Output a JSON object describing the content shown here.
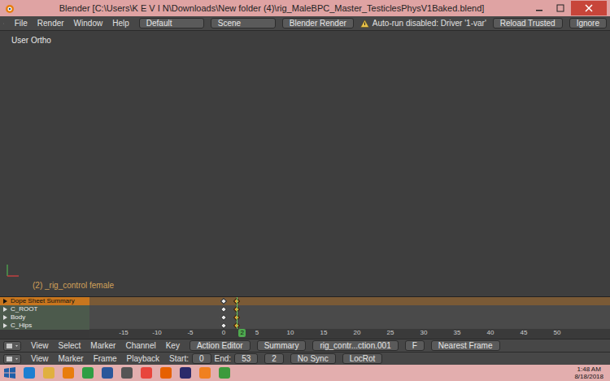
{
  "window": {
    "title": "Blender [C:\\Users\\K E V I N\\Downloads\\New folder (4)\\rig_MaleBPC_Master_TesticlesPhysV1Baked.blend]"
  },
  "info_header": {
    "menus": [
      "File",
      "Render",
      "Window",
      "Help"
    ],
    "layout": "Default",
    "scene": "Scene",
    "engine": "Blender Render",
    "warning": "Auto-run disabled: Driver '1-var'",
    "buttons": [
      "Reload Trusted",
      "Ignore"
    ]
  },
  "viewport": {
    "view_label": "User Ortho",
    "object_label": "(2) _rig_control female"
  },
  "dope_sheet": {
    "channels": [
      {
        "name": "Dope Sheet Summary",
        "kind": "summary",
        "keys": [
          {
            "frame": 0,
            "selected": false
          },
          {
            "frame": 2,
            "selected": true
          }
        ]
      },
      {
        "name": "C_ROOT",
        "kind": "channel",
        "keys": [
          {
            "frame": 0,
            "selected": false
          },
          {
            "frame": 2,
            "selected": true
          }
        ]
      },
      {
        "name": "Body",
        "kind": "channel",
        "keys": [
          {
            "frame": 0,
            "selected": false
          },
          {
            "frame": 2,
            "selected": true
          }
        ]
      },
      {
        "name": "C_Hips",
        "kind": "channel",
        "keys": [
          {
            "frame": 0,
            "selected": false
          },
          {
            "frame": 2,
            "selected": true
          }
        ]
      }
    ],
    "ruler": [
      "-15",
      "-10",
      "-5",
      "0",
      "5",
      "10",
      "15",
      "20",
      "25",
      "30",
      "35",
      "40",
      "45",
      "50"
    ],
    "current_frame": "2"
  },
  "dope_header": {
    "menus": [
      "View",
      "Select",
      "Marker",
      "Channel",
      "Key"
    ],
    "mode": "Action Editor",
    "summary": "Summary",
    "action": "rig_contr...ction.001",
    "fake_user": "F",
    "snap": "Nearest Frame"
  },
  "timeline_header": {
    "menus": [
      "View",
      "Marker",
      "Frame",
      "Playback"
    ],
    "start_label": "Start:",
    "start": "0",
    "end_label": "End:",
    "end": "53",
    "frame": "2",
    "sync": "No Sync",
    "keying": "LocRot"
  },
  "taskbar": {
    "time": "1:48 AM",
    "date": "8/18/2018"
  }
}
